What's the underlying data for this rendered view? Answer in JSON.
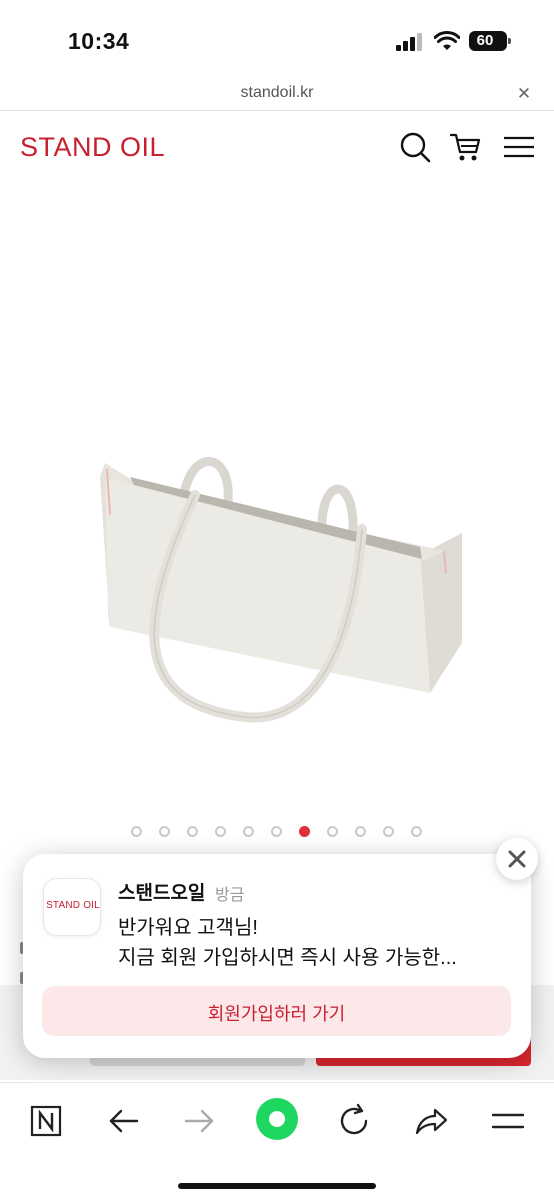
{
  "status_bar": {
    "time": "10:34",
    "battery": "60"
  },
  "browser": {
    "url": "standoil.kr",
    "close_glyph": "✕"
  },
  "site": {
    "logo": "STAND OIL"
  },
  "carousel": {
    "count": 11,
    "active_index": 6
  },
  "popup": {
    "avatar_text": "STAND OIL",
    "sender": "스탠드오일",
    "time": "방금",
    "message_line1": "반가워요 고객님!",
    "message_line2": "지금 회원 가입하시면 즉시 사용 가능한...",
    "cta_label": "회원가입하러 가기"
  },
  "colors": {
    "brand": "#c8202f",
    "accent_green": "#1ed760",
    "cta_bg": "#fde8e9"
  },
  "icons": {
    "header": [
      "search-icon",
      "cart-icon",
      "menu-icon"
    ],
    "toolbar": [
      "naver-n-icon",
      "back-arrow-icon",
      "forward-arrow-icon",
      "green-home-icon",
      "refresh-icon",
      "share-icon",
      "menu-icon"
    ]
  }
}
